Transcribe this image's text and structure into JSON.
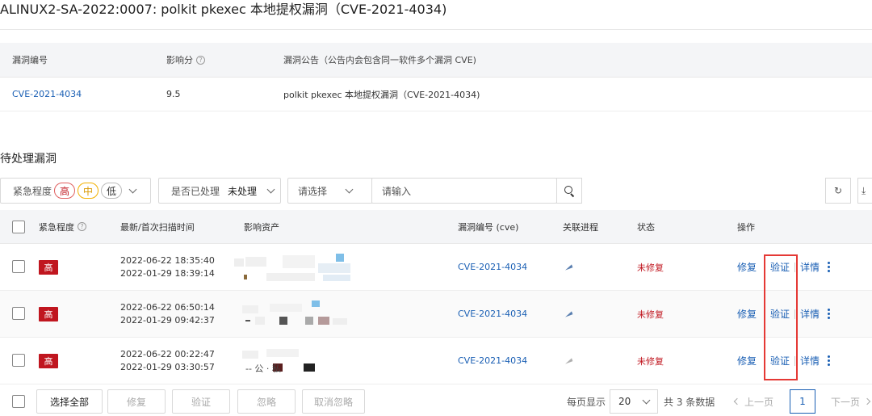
{
  "header": {
    "title": "ALINUX2-SA-2022:0007: polkit pkexec 本地提权漏洞（CVE-2021-4034)"
  },
  "info_table": {
    "columns": [
      "漏洞编号",
      "影响分",
      "漏洞公告（公告内会包含同一软件多个漏洞 CVE)"
    ],
    "row": {
      "cve": "CVE-2021-4034",
      "score": "9.5",
      "notice": "polkit pkexec 本地提权漏洞（CVE-2021-4034)"
    }
  },
  "pending": {
    "section_title": "待处理漏洞",
    "filters": {
      "severity_label": "紧急程度",
      "severity_options": [
        "高",
        "中",
        "低"
      ],
      "handled_label": "是否已处理",
      "handled_value": "未处理",
      "select_placeholder": "请选择",
      "search_placeholder": "请输入"
    },
    "columns": [
      "紧急程度",
      "最新/首次扫描时间",
      "影响资产",
      "漏洞编号 (cve)",
      "关联进程",
      "状态",
      "操作"
    ],
    "rows": [
      {
        "severity": "高",
        "latest": "2022-06-22 18:35:40",
        "first": "2022-01-29 18:39:14",
        "asset_glyph": "",
        "cve": "CVE-2021-4034",
        "process_icon": "send-icon",
        "status": "未修复"
      },
      {
        "severity": "高",
        "latest": "2022-06-22 06:50:14",
        "first": "2022-01-29 09:42:37",
        "asset_glyph": "",
        "cve": "CVE-2021-4034",
        "process_icon": "send-icon",
        "status": "未修复"
      },
      {
        "severity": "高",
        "latest": "2022-06-22 00:22:47",
        "first": "2022-01-29 03:30:57",
        "asset_glyph": "-- 公 · 私",
        "cve": "CVE-2021-4034",
        "process_icon": "send-icon-gray",
        "status": "未修复"
      }
    ],
    "ops": {
      "fix": "修复",
      "verify": "验证",
      "details": "详情"
    }
  },
  "footer": {
    "select_all": "选择全部",
    "fix": "修复",
    "verify": "验证",
    "ignore": "忽略",
    "unignore": "取消忽略",
    "per_page_label": "每页显示",
    "per_page_value": "20",
    "total": "共 3 条数据",
    "prev": "上一页",
    "current_page": "1",
    "next": "下一页"
  },
  "colors": {
    "link": "#1a5fb4",
    "danger": "#c0161f",
    "highlight": "#e53935"
  }
}
